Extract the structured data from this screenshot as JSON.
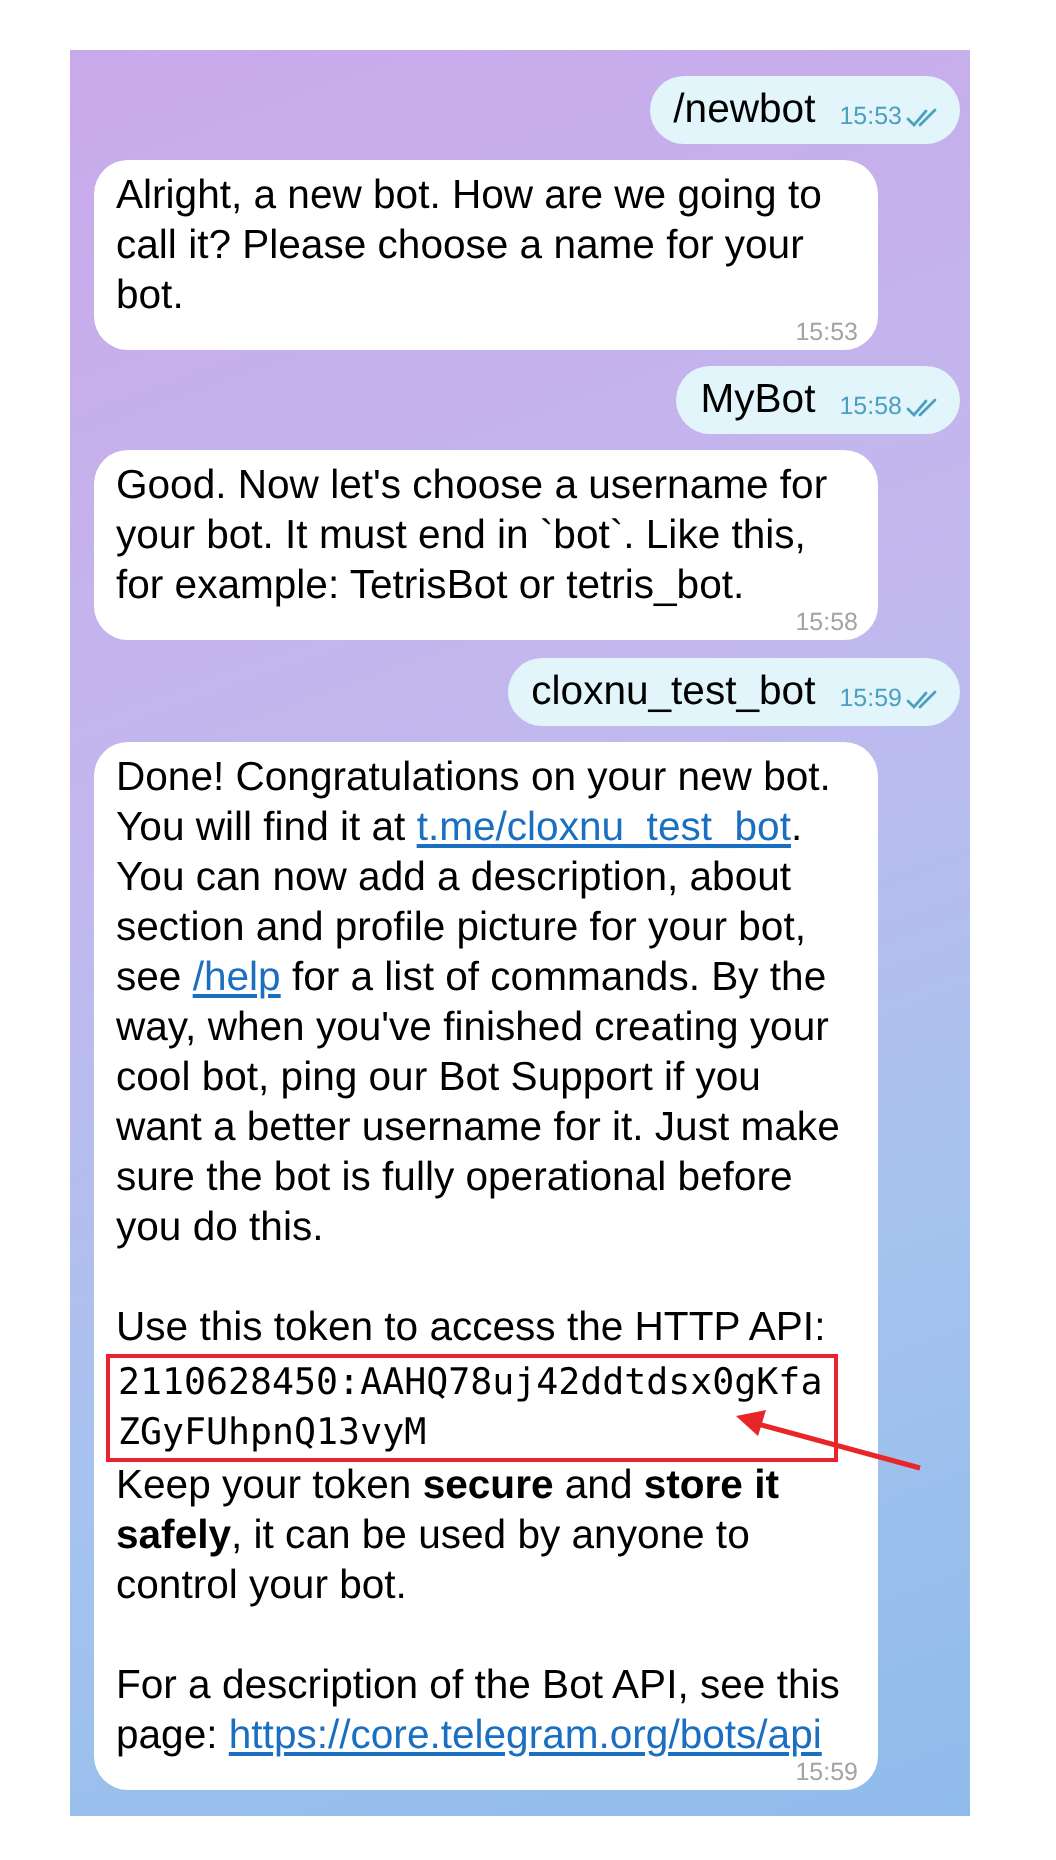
{
  "messages": [
    {
      "kind": "outgoing",
      "time": "15:53",
      "read": true,
      "paragraphs": [
        {
          "blocks": [
            {
              "kind": "text",
              "parts": [
                {
                  "kind": "text",
                  "text": "/newbot"
                }
              ]
            }
          ]
        }
      ]
    },
    {
      "kind": "incoming",
      "time": "15:53",
      "paragraphs": [
        {
          "blocks": [
            {
              "kind": "text",
              "parts": [
                {
                  "kind": "text",
                  "text": "Alright, a new bot. How are we going to call it? Please choose a name for your bot."
                }
              ]
            }
          ]
        }
      ]
    },
    {
      "kind": "outgoing",
      "time": "15:58",
      "read": true,
      "paragraphs": [
        {
          "blocks": [
            {
              "kind": "text",
              "parts": [
                {
                  "kind": "text",
                  "text": "MyBot"
                }
              ]
            }
          ]
        }
      ]
    },
    {
      "kind": "incoming",
      "time": "15:58",
      "paragraphs": [
        {
          "blocks": [
            {
              "kind": "text",
              "parts": [
                {
                  "kind": "text",
                  "text": "Good. Now let's choose a username for your bot. It must end in `bot`. Like this, for example: TetrisBot or tetris_bot."
                }
              ]
            }
          ]
        }
      ]
    },
    {
      "kind": "outgoing",
      "time": "15:59",
      "read": true,
      "paragraphs": [
        {
          "blocks": [
            {
              "kind": "text",
              "parts": [
                {
                  "kind": "text",
                  "text": "cloxnu_test_bot"
                }
              ]
            }
          ]
        }
      ]
    },
    {
      "kind": "incoming",
      "time": "15:59",
      "paragraphs": [
        {
          "blocks": [
            {
              "kind": "text",
              "parts": [
                {
                  "kind": "text",
                  "text": "Done! Congratulations on your new bot. You will find it at "
                },
                {
                  "kind": "link",
                  "text": "t.me/cloxnu_test_bot"
                },
                {
                  "kind": "text",
                  "text": ". You can now add a description, about section and profile picture for your bot, see "
                },
                {
                  "kind": "link",
                  "text": "/help"
                },
                {
                  "kind": "text",
                  "text": " for a list of commands. By the way, when you've finished creating your cool bot, ping our Bot Support if you want a better username for it. Just make sure the bot is fully operational before you do this."
                }
              ]
            }
          ]
        },
        {
          "blocks": [
            {
              "kind": "text",
              "parts": [
                {
                  "kind": "text",
                  "text": "Use this token to access the HTTP API:"
                }
              ]
            },
            {
              "kind": "code",
              "text": "2110628450:AAHQ78uj42ddtdsx0gKfaZGyFUhpnQ13vyM",
              "highlighted": true
            },
            {
              "kind": "text",
              "parts": [
                {
                  "kind": "text",
                  "text": "Keep your token **secure** and **store it safely**, it can be used by anyone to control your bot."
                }
              ]
            }
          ]
        },
        {
          "blocks": [
            {
              "kind": "text",
              "parts": [
                {
                  "kind": "text",
                  "text": "For a description of the Bot API, see this page: "
                },
                {
                  "kind": "link",
                  "text": "https://core.telegram.org/bots/api"
                }
              ]
            }
          ]
        }
      ]
    }
  ]
}
